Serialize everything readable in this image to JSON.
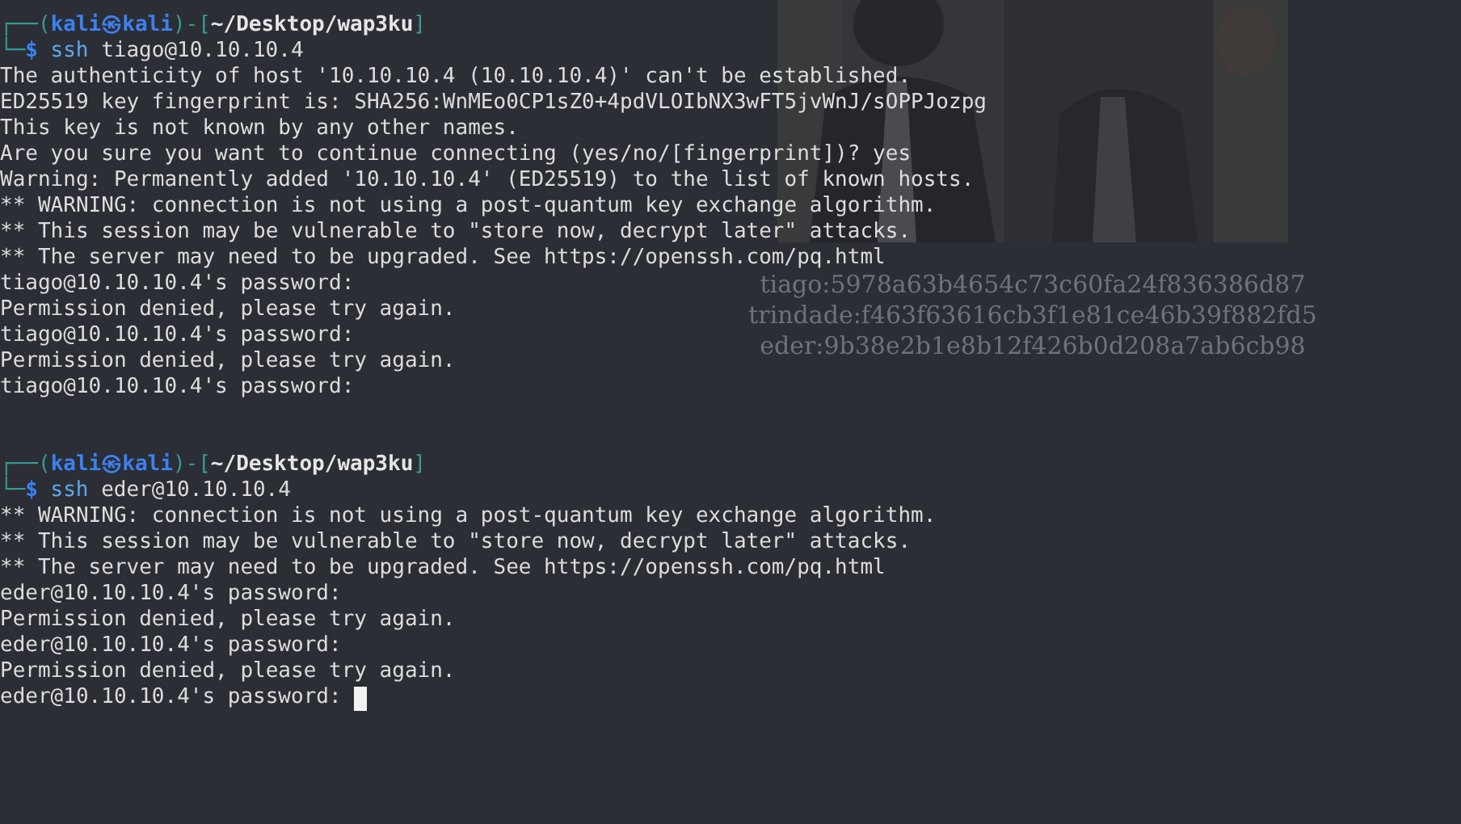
{
  "wallpaper": {
    "kind": "picture",
    "caption": [
      "tiago:5978a63b4654c73c60fa24f836386d87",
      "trindade:f463f63616cb3f1e81ce46b39f882fd5",
      "eder:9b38e2b1e8b12f426b0d208a7ab6cb98"
    ]
  },
  "sessions": [
    {
      "prompt": {
        "open": "┌──(",
        "user_host": "kali㉿kali",
        "mid": ")-[",
        "path": "~/Desktop/wap3ku",
        "close": "]"
      },
      "command": {
        "marker": "└─",
        "symbol": "$",
        "program": "ssh",
        "args": "tiago@10.10.10.4"
      },
      "output": [
        {
          "text": "The authenticity of host '10.10.10.4 (10.10.10.4)' can't be established.",
          "cursor": false
        },
        {
          "text": "ED25519 key fingerprint is: SHA256:WnMEo0CP1sZ0+4pdVLOIbNX3wFT5jvWnJ/sOPPJozpg",
          "cursor": false
        },
        {
          "text": "This key is not known by any other names.",
          "cursor": false
        },
        {
          "text": "Are you sure you want to continue connecting (yes/no/[fingerprint])? yes",
          "cursor": false
        },
        {
          "text": "Warning: Permanently added '10.10.10.4' (ED25519) to the list of known hosts.",
          "cursor": false
        },
        {
          "text": "** WARNING: connection is not using a post-quantum key exchange algorithm.",
          "cursor": false
        },
        {
          "text": "** This session may be vulnerable to \"store now, decrypt later\" attacks.",
          "cursor": false
        },
        {
          "text": "** The server may need to be upgraded. See https://openssh.com/pq.html",
          "cursor": false
        },
        {
          "text": "tiago@10.10.10.4's password:",
          "cursor": false
        },
        {
          "text": "Permission denied, please try again.",
          "cursor": false
        },
        {
          "text": "tiago@10.10.10.4's password:",
          "cursor": false
        },
        {
          "text": "Permission denied, please try again.",
          "cursor": false
        },
        {
          "text": "tiago@10.10.10.4's password:",
          "cursor": false
        }
      ]
    },
    {
      "prompt": {
        "open": "┌──(",
        "user_host": "kali㉿kali",
        "mid": ")-[",
        "path": "~/Desktop/wap3ku",
        "close": "]"
      },
      "command": {
        "marker": "└─",
        "symbol": "$",
        "program": "ssh",
        "args": "eder@10.10.10.4"
      },
      "output": [
        {
          "text": "** WARNING: connection is not using a post-quantum key exchange algorithm.",
          "cursor": false
        },
        {
          "text": "** This session may be vulnerable to \"store now, decrypt later\" attacks.",
          "cursor": false
        },
        {
          "text": "** The server may need to be upgraded. See https://openssh.com/pq.html",
          "cursor": false
        },
        {
          "text": "eder@10.10.10.4's password:",
          "cursor": false
        },
        {
          "text": "Permission denied, please try again.",
          "cursor": false
        },
        {
          "text": "eder@10.10.10.4's password:",
          "cursor": false
        },
        {
          "text": "Permission denied, please try again.",
          "cursor": false
        },
        {
          "text": "eder@10.10.10.4's password:",
          "cursor": true
        }
      ]
    }
  ]
}
